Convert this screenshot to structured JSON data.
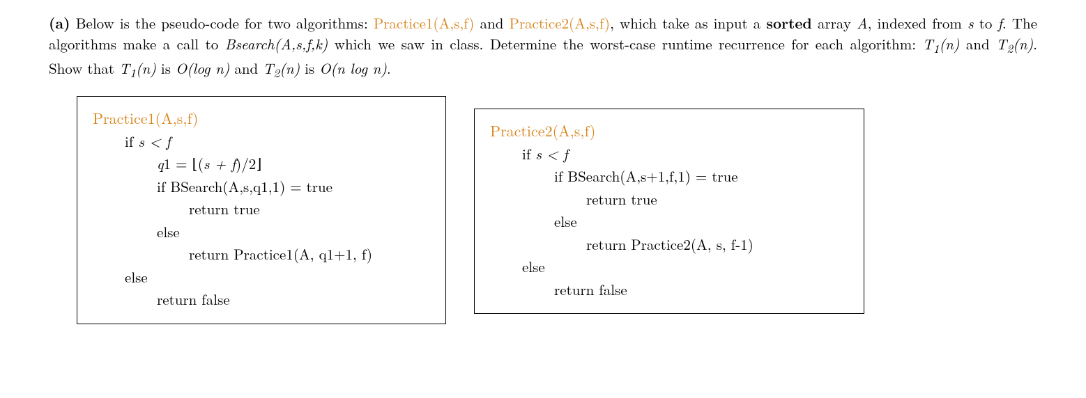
{
  "problem": {
    "label": "(a)",
    "text_prefix": "Below is the pseudo-code for two algorithms: ",
    "alg1_name": "Practice1(A,s,f)",
    "and": " and ",
    "alg2_name": "Practice2(A,s,f)",
    "text_mid1": ", which take as input a ",
    "sorted_word": "sorted",
    "text_mid2": " array ",
    "array_name": "A",
    "text_mid3": ", indexed from ",
    "s_var": "s",
    "to_word": " to ",
    "f_var": "f",
    "text_mid4": ". The algorithms make a call to ",
    "bsearch_call": "Bsearch(A,s,f,k)",
    "text_mid5": " which we saw in class. Determine the worst-case runtime recurrence for each algorithm: ",
    "t1n": "T",
    "t1sub": "1",
    "n_paren": "(n)",
    "and2": " and ",
    "t2n": "T",
    "t2sub": "2",
    "text_mid6": ". Show that ",
    "big_o_log": "O(log n)",
    "is_word": " is ",
    "big_o_nlog": "O(n log n)",
    "period": "."
  },
  "code1": {
    "title": "Practice1(A,s,f)",
    "line1_if": "if ",
    "line1_cond": "s < f",
    "line2_q1": "q",
    "line2_q1sub": "1 = ⌊(",
    "line2_sf": "s + f",
    "line2_rest": ")/2⌋",
    "line3": "if BSearch(A,s,q1,1) = true",
    "line4": "return true",
    "line5": "else",
    "line6": "return Practice1(A, q1+1, f)",
    "line7": "else",
    "line8": "return false"
  },
  "code2": {
    "title": "Practice2(A,s,f)",
    "line1_if": "if ",
    "line1_cond": "s < f",
    "line2": "if BSearch(A,s+1,f,1) = true",
    "line3": "return true",
    "line4": "else",
    "line5": "return Practice2(A, s, f-1)",
    "line6": "else",
    "line7": "return false"
  }
}
